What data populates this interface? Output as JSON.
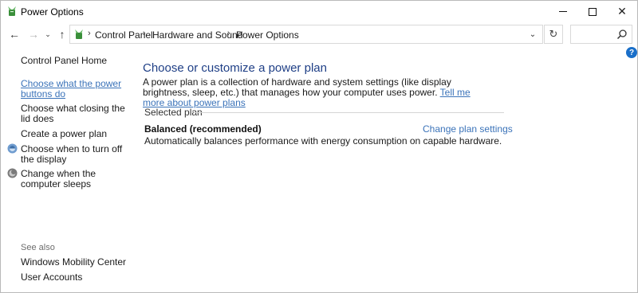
{
  "window": {
    "title": "Power Options",
    "minimize_label": "",
    "maximize_label": "",
    "close_label": "✕"
  },
  "navigation": {
    "back_glyph": "←",
    "forward_glyph": "→",
    "recent_glyph": "⌄",
    "up_glyph": "↑",
    "breadcrumbs": [
      "Control Panel",
      "Hardware and Sound",
      "Power Options"
    ],
    "separator": "›",
    "dropdown_glyph": "⌄",
    "refresh_glyph": "↻",
    "search_placeholder": ""
  },
  "help": {
    "label": "?"
  },
  "sidebar": {
    "home_label": "Control Panel Home",
    "items": [
      {
        "label": "Choose what the power buttons do",
        "active": true,
        "icon": ""
      },
      {
        "label": "Choose what closing the lid does",
        "active": false,
        "icon": ""
      },
      {
        "label": "Create a power plan",
        "active": false,
        "icon": ""
      },
      {
        "label": "Choose when to turn off the display",
        "active": false,
        "icon": "display-icon"
      },
      {
        "label": "Change when the computer sleeps",
        "active": false,
        "icon": "sleep-icon"
      }
    ],
    "see_also_label": "See also",
    "see_also_items": [
      "Windows Mobility Center",
      "User Accounts"
    ]
  },
  "main": {
    "title": "Choose or customize a power plan",
    "description": "A power plan is a collection of hardware and system settings (like display brightness, sleep, etc.) that manages how your computer uses power.",
    "learn_more_link": "Tell me more about power plans",
    "section_title": "Selected plan",
    "plan": {
      "name": "Balanced (recommended)",
      "settings_link": "Change plan settings",
      "description": "Automatically balances performance with energy consumption on capable hardware."
    }
  },
  "colors": {
    "link": "#3b73b9",
    "title": "#1f3f86",
    "help_badge": "#1a6fc9",
    "border": "#d9d9d9"
  }
}
